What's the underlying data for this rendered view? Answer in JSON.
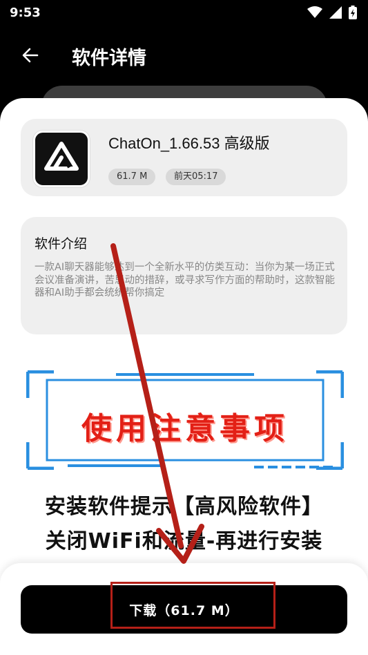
{
  "status_bar": {
    "time": "9:53"
  },
  "header": {
    "title": "软件详情"
  },
  "app": {
    "name": "ChatOn_1.66.53 高级版",
    "size": "61.7 M",
    "date": "前天05:17"
  },
  "intro": {
    "title": "软件介绍",
    "text": "一款AI聊天器能够达到一个全新水平的仿类互动：当你为某一场正式会议准备演讲，苦思动的措辞，或寻求写作方面的帮助时，这款智能器和AI助手都会统统帮你搞定"
  },
  "poster": {
    "headline": "使用注意事项",
    "line1": "安装软件提示【高风险软件】",
    "line2": "关闭WiFi和流量-再进行安装"
  },
  "download": {
    "label": "下载（61.7 M）"
  },
  "colors": {
    "accent_red": "#b52018",
    "button": "#000000"
  }
}
